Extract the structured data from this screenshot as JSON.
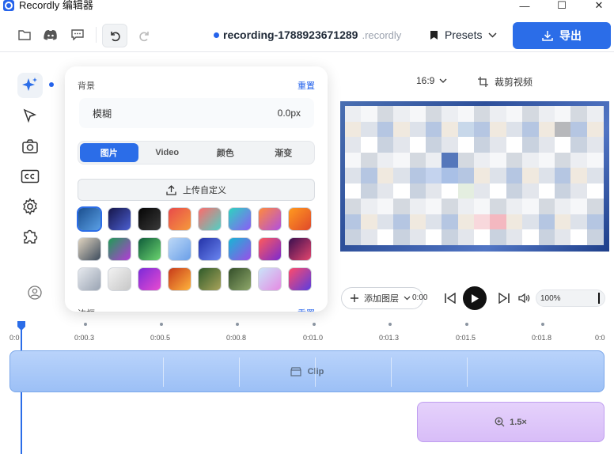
{
  "window": {
    "app_title": "Recordly 编辑器",
    "minimize_glyph": "—",
    "maximize_glyph": "☐",
    "close_glyph": "✕"
  },
  "toolbar": {
    "file_name": "recording-1788923671289",
    "file_ext": ".recordly",
    "presets_label": "Presets",
    "export_label": "导出"
  },
  "popover": {
    "title": "背景",
    "reset_label": "重置",
    "blur_label": "模糊",
    "blur_value": "0.0px",
    "tabs": [
      "图片",
      "Video",
      "颜色",
      "渐变"
    ],
    "active_tab": "图片",
    "upload_label": "上传自定义",
    "next_section_title": "边框",
    "next_section_reset": "重置",
    "wallpapers": [
      {
        "id": "w1",
        "colors": [
          "#1b4f8f",
          "#5aa0e6"
        ],
        "selected": true
      },
      {
        "id": "w2",
        "colors": [
          "#16164a",
          "#4b5fd1"
        ]
      },
      {
        "id": "w3",
        "colors": [
          "#050505",
          "#3a3a3a"
        ]
      },
      {
        "id": "w4",
        "colors": [
          "#e84a4a",
          "#f59a3c"
        ]
      },
      {
        "id": "w5",
        "colors": [
          "#ff6b6b",
          "#4fd1c5"
        ]
      },
      {
        "id": "w6",
        "colors": [
          "#2dd4bf",
          "#8b5cf6"
        ]
      },
      {
        "id": "w7",
        "colors": [
          "#ff8a3c",
          "#b04fe0"
        ]
      },
      {
        "id": "w8",
        "colors": [
          "#ff9a1f",
          "#e0482b"
        ]
      },
      {
        "id": "w9",
        "colors": [
          "#e0d4c0",
          "#3c4b5c"
        ]
      },
      {
        "id": "w10",
        "colors": [
          "#1f9d55",
          "#b43ad8"
        ]
      },
      {
        "id": "w11",
        "colors": [
          "#0f5c3a",
          "#6bd46f"
        ]
      },
      {
        "id": "w12",
        "colors": [
          "#bcd8f7",
          "#6a9fe8"
        ]
      },
      {
        "id": "w13",
        "colors": [
          "#2433a8",
          "#6a85f0"
        ]
      },
      {
        "id": "w14",
        "colors": [
          "#17b6d4",
          "#9b4ee8"
        ]
      },
      {
        "id": "w15",
        "colors": [
          "#ff5a5a",
          "#7b2ad1"
        ]
      },
      {
        "id": "w16",
        "colors": [
          "#3a0f4f",
          "#e3456e"
        ]
      },
      {
        "id": "w17",
        "colors": [
          "#e6e9ee",
          "#9aa4b3"
        ]
      },
      {
        "id": "w18",
        "colors": [
          "#f2f2f2",
          "#c7c7c7"
        ]
      },
      {
        "id": "w19",
        "colors": [
          "#7a2ad8",
          "#e94bd0"
        ]
      },
      {
        "id": "w20",
        "colors": [
          "#c73a1a",
          "#ffb43c"
        ]
      },
      {
        "id": "w21",
        "colors": [
          "#2f5b2a",
          "#a8a35a"
        ]
      },
      {
        "id": "w22",
        "colors": [
          "#344f2a",
          "#8fa86a"
        ]
      },
      {
        "id": "w23",
        "colors": [
          "#c9e4f9",
          "#e58ae3"
        ]
      },
      {
        "id": "w24",
        "colors": [
          "#ff4a6a",
          "#5a3de0"
        ]
      }
    ]
  },
  "canvas": {
    "aspect_ratio": "16:9",
    "crop_label": "裁剪视频"
  },
  "player": {
    "add_layer_label": "添加图层",
    "time_current": "0:00",
    "volume": "100%"
  },
  "timeline": {
    "ruler": [
      "0:0",
      "0:00.3",
      "0:00.5",
      "0:00.8",
      "0:01.0",
      "0:01.3",
      "0:01.5",
      "0:01.8",
      "0:0"
    ],
    "clip_label": "Clip",
    "zoom_label": "1.5×"
  }
}
